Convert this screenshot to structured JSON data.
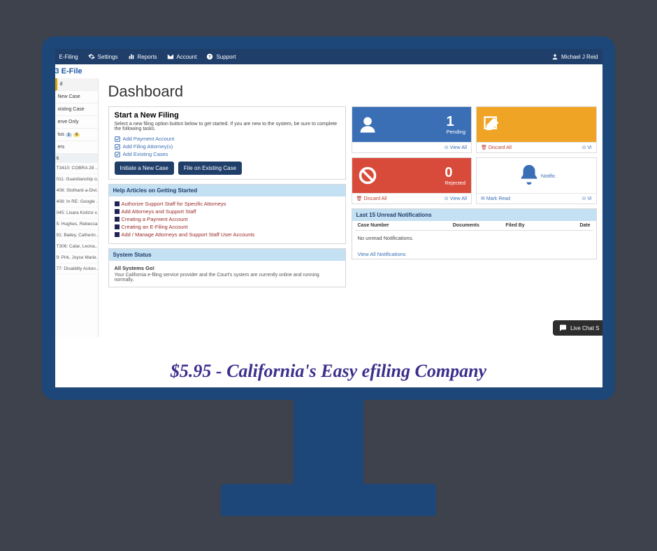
{
  "topbar": {
    "items": [
      "E-Filing",
      "Settings",
      "Reports",
      "Account",
      "Support"
    ],
    "user": "Michael J Reid"
  },
  "logo": "3 E-File",
  "sidebar": {
    "nav": [
      {
        "label": "d",
        "selected": true
      },
      {
        "label": "New Case"
      },
      {
        "label": "xisting Case"
      },
      {
        "label": "erve Only"
      },
      {
        "label": "tus",
        "badge1": "1",
        "badge2": "6"
      },
      {
        "label": "ers"
      }
    ],
    "recent_header": "s",
    "recent": [
      "T3410: COBRA 28 ...",
      "011: Guardianship o...",
      "408: Stothard-a-Divi...",
      "408: In RE: Google ...",
      "045: Lisara Kotizsi v...",
      "5: Hughes, Rebecca...",
      "91: Bailey, Catherin...",
      "T306: Calar, Leona...",
      "9: Pirk, Joyce Marie...",
      "77: Disability Action..."
    ]
  },
  "page": {
    "title": "Dashboard"
  },
  "start": {
    "title": "Start a New Filing",
    "desc": "Select a new filing option button below to get started. If you are new to the system, be sure to complete the following tasks.",
    "tasks": [
      "Add Payment Account",
      "Add Filing Attorney(s)",
      "Add Existing Cases"
    ],
    "btn_new": "Initiate a New Case",
    "btn_existing": "File on Existing Case"
  },
  "help": {
    "header": "Help Articles on Getting Started",
    "links": [
      "Authorize Support Staff for Specific Attorneys",
      "Add Attorneys and Support Staff",
      "Creating a Payment Account",
      "Creating an E-Filing Account",
      "Add / Manage Attorneys and Support Staff User Accounts"
    ]
  },
  "system": {
    "header": "System Status",
    "ok": "All Systems Go!",
    "msg": "Your California e-filing service provider and the Court's system are currently online and running normally."
  },
  "tiles": {
    "pending": {
      "count": "1",
      "label": "Pending",
      "view": "View All"
    },
    "rejected": {
      "count": "0",
      "label": "Rejected",
      "discard": "Discard All",
      "view": "View All"
    },
    "drafts": {
      "discard": "Discard All",
      "view": "Vi"
    },
    "notif": {
      "mark": "Mark Read",
      "view": "Vi",
      "side": "Notific"
    }
  },
  "notifications": {
    "header": "Last 15 Unread Notifications",
    "cols": [
      "Case Number",
      "Documents",
      "Filed By",
      "Date"
    ],
    "empty": "No unread Notifications.",
    "view_all": "View All Notifications"
  },
  "livechat": "Live Chat S",
  "tagline": "$5.95 - California's Easy efiling Company"
}
